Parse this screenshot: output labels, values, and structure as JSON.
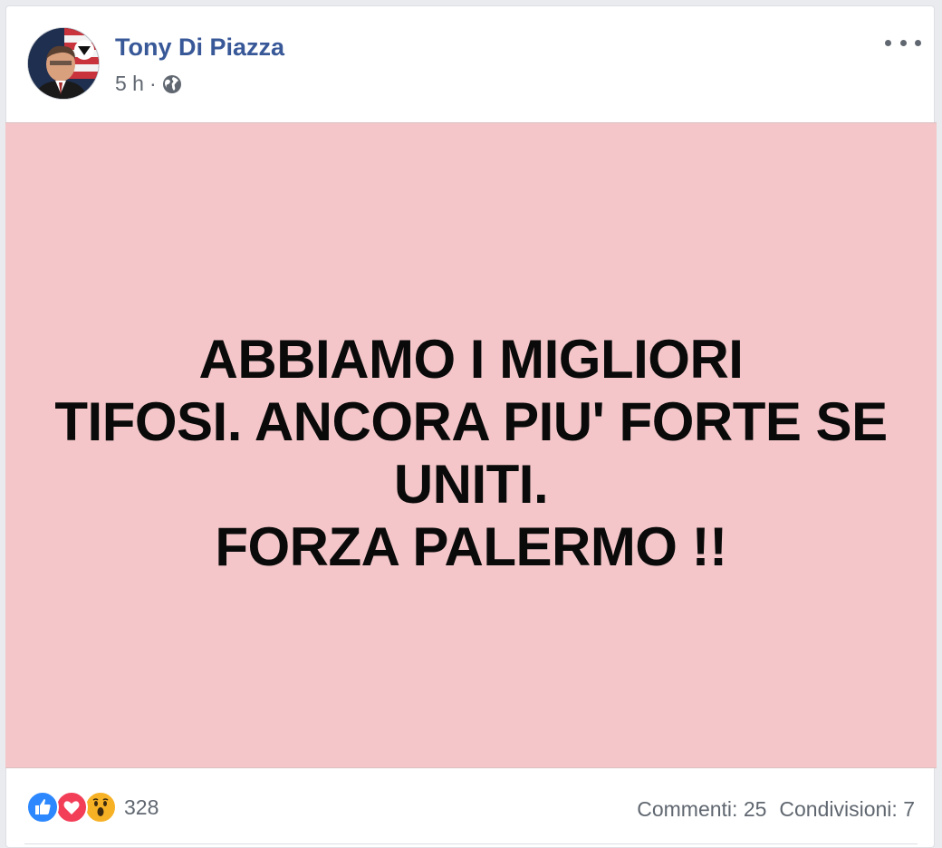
{
  "post": {
    "author": "Tony Di Piazza",
    "time": "5 h",
    "separator": "·",
    "privacy_icon": "globe-icon",
    "text_lines": [
      "ABBIAMO I MIGLIORI",
      "TIFOSI. ANCORA PIU' FORTE SE",
      "UNITI.",
      "FORZA PALERMO !!"
    ],
    "background_color": "#f4c6c9"
  },
  "reactions": {
    "icons": [
      "like-icon",
      "love-icon",
      "wow-icon"
    ],
    "count": "328"
  },
  "stats": {
    "comments": "Commenti: 25",
    "shares": "Condivisioni: 7"
  },
  "colors": {
    "author_name": "#385898",
    "meta_text": "#606770",
    "like": "#2d88ff",
    "love": "#f33e58",
    "wow": "#f7b125"
  }
}
